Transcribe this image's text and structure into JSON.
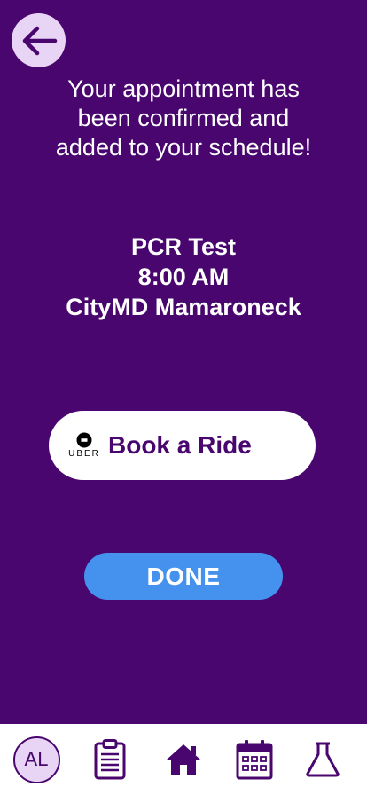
{
  "colors": {
    "background": "#48066e",
    "accent": "#4592ee",
    "light": "#e8d4f4",
    "white": "#ffffff"
  },
  "header": {
    "back_icon": "arrow-left-icon"
  },
  "confirmation": {
    "lines": [
      "Your appointment has",
      "been confirmed and",
      "added to your schedule!"
    ]
  },
  "appointment": {
    "test": "PCR Test",
    "time": "8:00 AM",
    "location": "CityMD Mamaroneck"
  },
  "ride_button": {
    "brand": "UBER",
    "label": "Book a Ride"
  },
  "done_button": {
    "label": "DONE"
  },
  "tabbar": {
    "avatar_initials": "AL",
    "tabs": [
      "profile",
      "clipboard-icon",
      "home-icon",
      "calendar-icon",
      "flask-icon"
    ]
  }
}
